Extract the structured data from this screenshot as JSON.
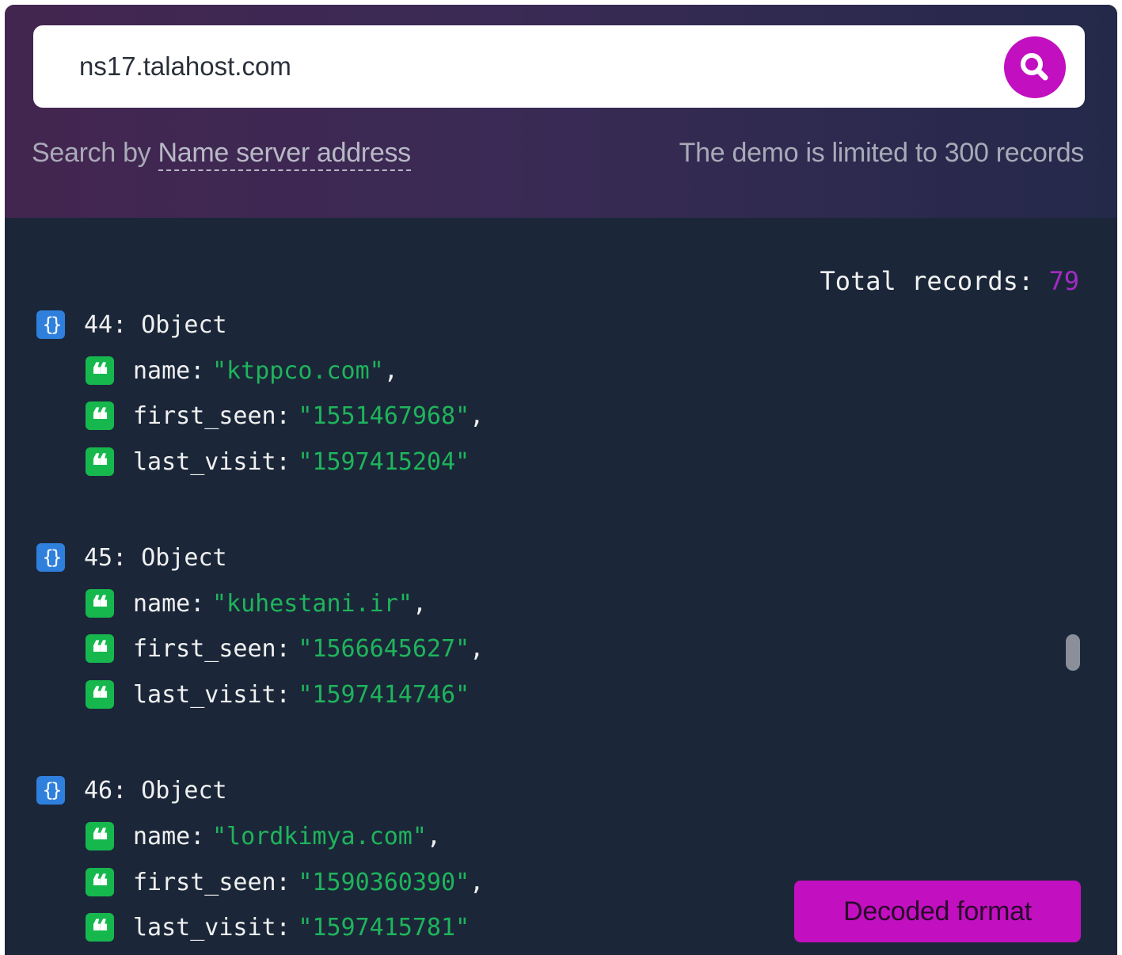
{
  "search": {
    "value": "ns17.talahost.com",
    "button_icon": "search-icon"
  },
  "hint": {
    "prefix": "Search by ",
    "link": "Name server address",
    "limit": "The demo is limited to 300 records"
  },
  "summary": {
    "label": "Total records:",
    "count": "79"
  },
  "records": [
    {
      "header": "44: Object",
      "fields": [
        {
          "key": "name:",
          "value": "\"ktppco.com\"",
          "comma": ","
        },
        {
          "key": "first_seen:",
          "value": "\"1551467968\"",
          "comma": ","
        },
        {
          "key": "last_visit:",
          "value": "\"1597415204\"",
          "comma": ""
        }
      ]
    },
    {
      "header": "45: Object",
      "fields": [
        {
          "key": "name:",
          "value": "\"kuhestani.ir\"",
          "comma": ","
        },
        {
          "key": "first_seen:",
          "value": "\"1566645627\"",
          "comma": ","
        },
        {
          "key": "last_visit:",
          "value": "\"1597414746\"",
          "comma": ""
        }
      ]
    },
    {
      "header": "46: Object",
      "fields": [
        {
          "key": "name:",
          "value": "\"lordkimya.com\"",
          "comma": ","
        },
        {
          "key": "first_seen:",
          "value": "\"1590360390\"",
          "comma": ","
        },
        {
          "key": "last_visit:",
          "value": "\"1597415781\"",
          "comma": ""
        }
      ]
    }
  ],
  "icons": {
    "object": "{}",
    "string": "❝"
  },
  "actions": {
    "decoded_label": "Decoded format"
  },
  "colors": {
    "accent": "#c20fc0",
    "string_value": "#1fb45b",
    "object_icon": "#2f80dd",
    "count": "#a32bc5"
  }
}
